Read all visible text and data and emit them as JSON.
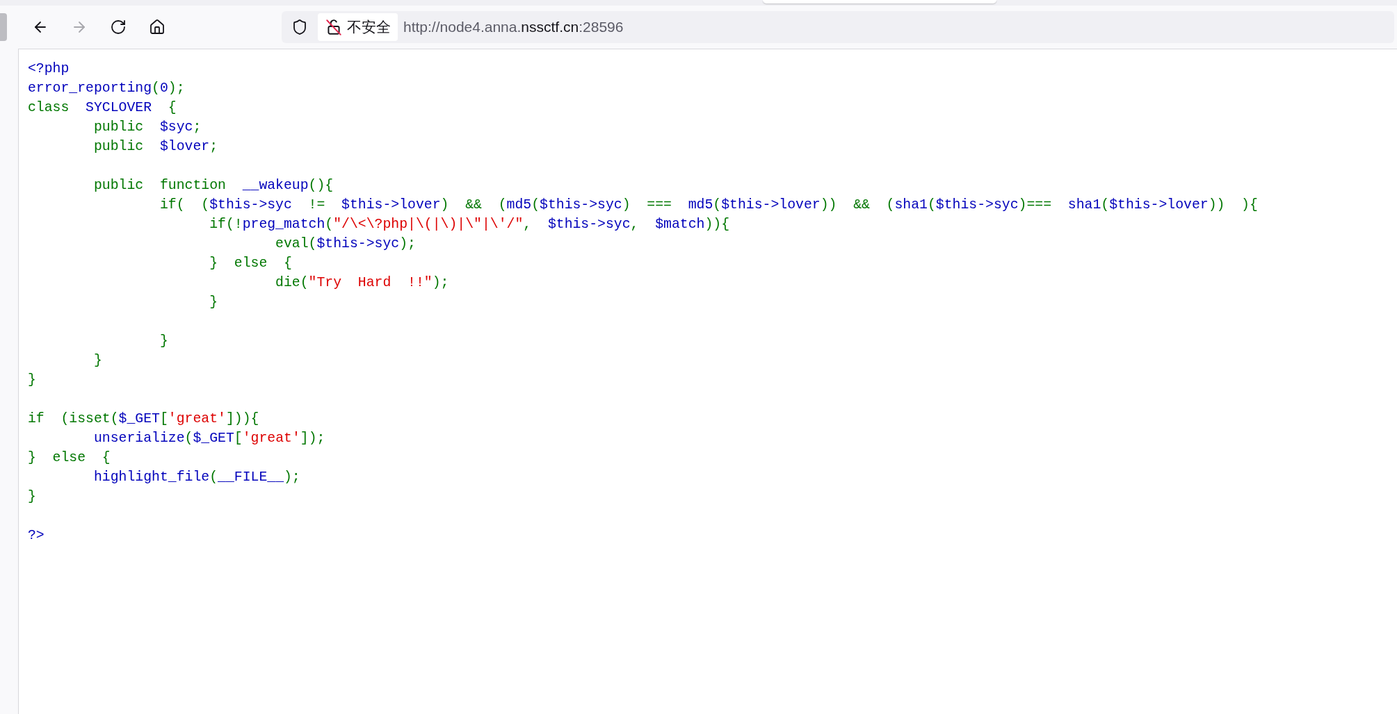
{
  "toolbar": {
    "nav_buttons": [
      {
        "kind": "back",
        "disabled": false
      },
      {
        "kind": "forward",
        "disabled": true
      },
      {
        "kind": "reload",
        "disabled": false
      },
      {
        "kind": "home",
        "disabled": false
      }
    ],
    "address_bar": {
      "security_label": "不安全",
      "url_parts": [
        {
          "text": "http://node4.anna.",
          "emphasis": false
        },
        {
          "text": "nssctf.cn",
          "emphasis": true
        },
        {
          "text": ":28596",
          "emphasis": false
        }
      ]
    }
  },
  "code": {
    "lines": [
      {
        "tokens": [
          {
            "kind": "default",
            "text": "<?php"
          }
        ]
      },
      {
        "tokens": [
          {
            "kind": "default",
            "text": "error_reporting"
          },
          {
            "kind": "keyword",
            "text": "("
          },
          {
            "kind": "default",
            "text": "0"
          },
          {
            "kind": "keyword",
            "text": ");"
          }
        ]
      },
      {
        "tokens": [
          {
            "kind": "keyword",
            "text": "class  "
          },
          {
            "kind": "default",
            "text": "SYCLOVER  "
          },
          {
            "kind": "keyword",
            "text": "{"
          }
        ]
      },
      {
        "tokens": [
          {
            "kind": "keyword",
            "text": "        public  "
          },
          {
            "kind": "default",
            "text": "$syc"
          },
          {
            "kind": "keyword",
            "text": ";"
          }
        ]
      },
      {
        "tokens": [
          {
            "kind": "keyword",
            "text": "        public  "
          },
          {
            "kind": "default",
            "text": "$lover"
          },
          {
            "kind": "keyword",
            "text": ";"
          }
        ]
      },
      {
        "kind": "blank"
      },
      {
        "tokens": [
          {
            "kind": "keyword",
            "text": "        public  function  "
          },
          {
            "kind": "default",
            "text": "__wakeup"
          },
          {
            "kind": "keyword",
            "text": "(){"
          }
        ]
      },
      {
        "tokens": [
          {
            "kind": "keyword",
            "text": "                if(  ("
          },
          {
            "kind": "default",
            "text": "$this->syc  "
          },
          {
            "kind": "keyword",
            "text": "!=  "
          },
          {
            "kind": "default",
            "text": "$this->lover"
          },
          {
            "kind": "keyword",
            "text": ")  &&  ("
          },
          {
            "kind": "default",
            "text": "md5"
          },
          {
            "kind": "keyword",
            "text": "("
          },
          {
            "kind": "default",
            "text": "$this->syc"
          },
          {
            "kind": "keyword",
            "text": ")  ===  "
          },
          {
            "kind": "default",
            "text": "md5"
          },
          {
            "kind": "keyword",
            "text": "("
          },
          {
            "kind": "default",
            "text": "$this->lover"
          },
          {
            "kind": "keyword",
            "text": "))  &&  ("
          },
          {
            "kind": "default",
            "text": "sha1"
          },
          {
            "kind": "keyword",
            "text": "("
          },
          {
            "kind": "default",
            "text": "$this->syc"
          },
          {
            "kind": "keyword",
            "text": ")===  "
          },
          {
            "kind": "default",
            "text": "sha1"
          },
          {
            "kind": "keyword",
            "text": "("
          },
          {
            "kind": "default",
            "text": "$this->lover"
          },
          {
            "kind": "keyword",
            "text": "))  ){"
          }
        ]
      },
      {
        "tokens": [
          {
            "kind": "keyword",
            "text": "                      if(!"
          },
          {
            "kind": "default",
            "text": "preg_match"
          },
          {
            "kind": "keyword",
            "text": "("
          },
          {
            "kind": "string",
            "text": "\"/\\<\\?php|\\(|\\)|\\\"|\\'/\""
          },
          {
            "kind": "keyword",
            "text": ",  "
          },
          {
            "kind": "default",
            "text": "$this->syc"
          },
          {
            "kind": "keyword",
            "text": ",  "
          },
          {
            "kind": "default",
            "text": "$match"
          },
          {
            "kind": "keyword",
            "text": ")){"
          }
        ]
      },
      {
        "tokens": [
          {
            "kind": "keyword",
            "text": "                              eval("
          },
          {
            "kind": "default",
            "text": "$this->syc"
          },
          {
            "kind": "keyword",
            "text": ");"
          }
        ]
      },
      {
        "tokens": [
          {
            "kind": "keyword",
            "text": "                      }  else  {"
          }
        ]
      },
      {
        "tokens": [
          {
            "kind": "keyword",
            "text": "                              die("
          },
          {
            "kind": "string",
            "text": "\"Try  Hard  !!\""
          },
          {
            "kind": "keyword",
            "text": ");"
          }
        ]
      },
      {
        "tokens": [
          {
            "kind": "keyword",
            "text": "                      }"
          }
        ]
      },
      {
        "kind": "blank"
      },
      {
        "tokens": [
          {
            "kind": "keyword",
            "text": "                }"
          }
        ]
      },
      {
        "tokens": [
          {
            "kind": "keyword",
            "text": "        }"
          }
        ]
      },
      {
        "tokens": [
          {
            "kind": "keyword",
            "text": "}"
          }
        ]
      },
      {
        "kind": "blank"
      },
      {
        "tokens": [
          {
            "kind": "keyword",
            "text": "if  (isset("
          },
          {
            "kind": "default",
            "text": "$_GET"
          },
          {
            "kind": "keyword",
            "text": "["
          },
          {
            "kind": "string",
            "text": "'great'"
          },
          {
            "kind": "keyword",
            "text": "])){"
          }
        ]
      },
      {
        "tokens": [
          {
            "kind": "default",
            "text": "        unserialize"
          },
          {
            "kind": "keyword",
            "text": "("
          },
          {
            "kind": "default",
            "text": "$_GET"
          },
          {
            "kind": "keyword",
            "text": "["
          },
          {
            "kind": "string",
            "text": "'great'"
          },
          {
            "kind": "keyword",
            "text": "]);"
          }
        ]
      },
      {
        "tokens": [
          {
            "kind": "keyword",
            "text": "}  else  {"
          }
        ]
      },
      {
        "tokens": [
          {
            "kind": "default",
            "text": "        highlight_file"
          },
          {
            "kind": "keyword",
            "text": "("
          },
          {
            "kind": "default",
            "text": "__FILE__"
          },
          {
            "kind": "keyword",
            "text": ");"
          }
        ]
      },
      {
        "tokens": [
          {
            "kind": "keyword",
            "text": "}"
          }
        ]
      },
      {
        "kind": "blank"
      },
      {
        "tokens": [
          {
            "kind": "default",
            "text": "?>"
          }
        ]
      }
    ]
  }
}
